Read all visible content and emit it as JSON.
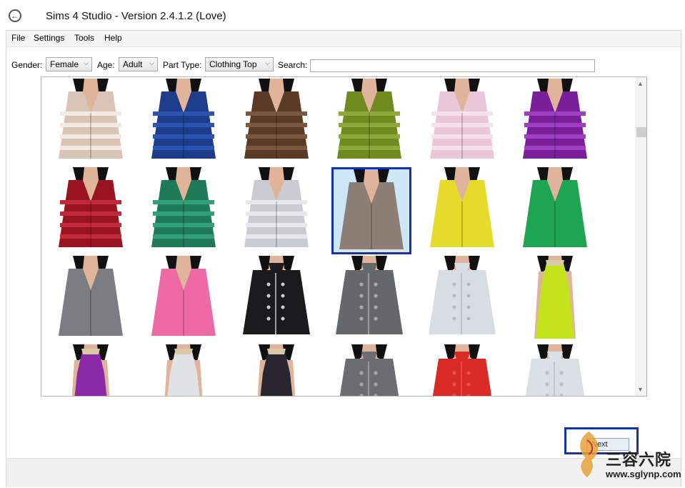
{
  "app": {
    "title": "Sims 4 Studio - Version 2.4.1.2  (Love)"
  },
  "menu": [
    "File",
    "Settings",
    "Tools",
    "Help"
  ],
  "filters": {
    "gender_label": "Gender:",
    "gender_value": "Female",
    "age_label": "Age:",
    "age_value": "Adult",
    "part_type_label": "Part Type:",
    "part_type_value": "Clothing Top",
    "search_label": "Search:",
    "search_value": ""
  },
  "gallery": {
    "selected_index": 9,
    "items": [
      {
        "style": "cardigan",
        "color": "#d9c4b6",
        "stripe": "#f2e9e2"
      },
      {
        "style": "cardigan",
        "color": "#1d3c8a",
        "stripe": "#2b55b0"
      },
      {
        "style": "cardigan",
        "color": "#5b3a26",
        "stripe": "#7b5740"
      },
      {
        "style": "cardigan",
        "color": "#6f8a1e",
        "stripe": "#8ea83a"
      },
      {
        "style": "cardigan",
        "color": "#e9c7d6",
        "stripe": "#f6e2ea"
      },
      {
        "style": "cardigan",
        "color": "#7a1f9a",
        "stripe": "#9e3fc2"
      },
      {
        "style": "cardigan",
        "color": "#9a1321",
        "stripe": "#c02a3a"
      },
      {
        "style": "cardigan",
        "color": "#1f7a58",
        "stripe": "#33a07a"
      },
      {
        "style": "cardigan",
        "color": "#c9ccd3",
        "stripe": "#e6e8ec"
      },
      {
        "style": "cardigan-plain",
        "color": "#8d7e76",
        "stripe": "#8d7e76"
      },
      {
        "style": "cardigan-plain",
        "color": "#e6da2a",
        "stripe": "#e6da2a"
      },
      {
        "style": "cardigan-plain",
        "color": "#1ea553",
        "stripe": "#1ea553"
      },
      {
        "style": "cardigan-plain",
        "color": "#7b7d82",
        "stripe": "#7b7d82"
      },
      {
        "style": "cardigan-plain",
        "color": "#ee6aa6",
        "stripe": "#ee6aa6"
      },
      {
        "style": "chef",
        "color": "#1b1b1d",
        "stripe": "#cfcfcf"
      },
      {
        "style": "chef",
        "color": "#65686b",
        "stripe": "#a9abae"
      },
      {
        "style": "chef",
        "color": "#d8dde3",
        "stripe": "#b4bac2"
      },
      {
        "style": "halter",
        "color": "#c5e31b",
        "stripe": "#c5e31b"
      },
      {
        "style": "halter",
        "color": "#8b2aa6",
        "stripe": "#8b2aa6"
      },
      {
        "style": "halter",
        "color": "#dfe3e6",
        "stripe": "#dfe3e6"
      },
      {
        "style": "halter",
        "color": "#2a2630",
        "stripe": "#2a2630"
      },
      {
        "style": "chef",
        "color": "#6b6d70",
        "stripe": "#a6a8ab"
      },
      {
        "style": "chef",
        "color": "#d92a26",
        "stripe": "#e65450"
      },
      {
        "style": "chef",
        "color": "#dadfe5",
        "stripe": "#b8bec6"
      }
    ]
  },
  "footer": {
    "next_label": "Next"
  },
  "watermark": {
    "line1": "三容六院",
    "line2": "www.sglynp.com"
  },
  "colors": {
    "selection_border": "#1433a6",
    "selection_fill": "#cfe6f7",
    "skin": "#e0b49a",
    "hair": "#111111"
  }
}
